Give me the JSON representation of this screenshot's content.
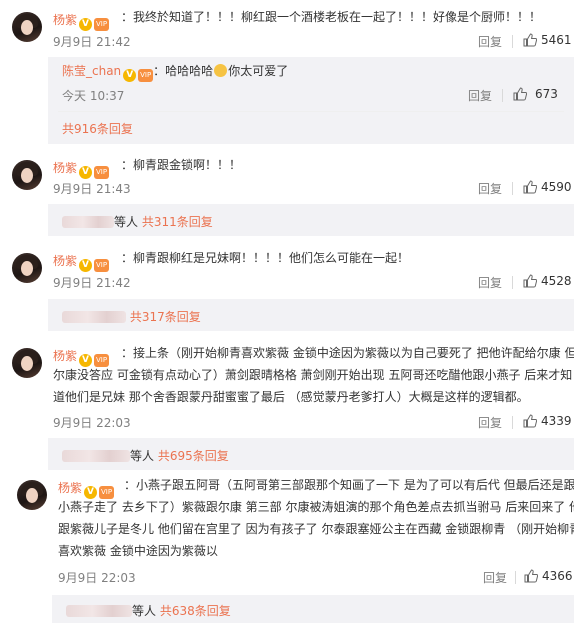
{
  "comments": [
    {
      "user": "杨紫",
      "text": "：我终於知道了！！！柳红跟一个酒楼老板在一起了！！！好像是个厨师！！！",
      "time": "9月9日 21:42",
      "reply_label": "回复",
      "likes": "5461",
      "sub": {
        "user": "陈莹_chan",
        "text": "：哈哈哈哈",
        "text2": "你太可爱了",
        "time": "今天 10:37",
        "reply_label": "回复",
        "likes": "673"
      },
      "more": "共916条回复"
    },
    {
      "user": "杨紫",
      "text": "：柳青跟金锁啊！！！",
      "time": "9月9日 21:43",
      "reply_label": "回复",
      "likes": "4590",
      "more_who": "等人",
      "more": "共311条回复"
    },
    {
      "user": "杨紫",
      "text": "：柳青跟柳红是兄妹啊！！！！他们怎么可能在一起！",
      "time": "9月9日 21:42",
      "reply_label": "回复",
      "likes": "4528",
      "more": "共317条回复"
    },
    {
      "user": "杨紫",
      "lines": [
        "：接上条（刚开始柳青喜欢紫薇 金锁中途因为紫薇以为自己要死了 把他许配给尔康 但",
        "尔康没答应 可金锁有点动心了）萧剑跟晴格格 萧剑刚开始出现 五阿哥还吃醋他跟小燕子 后来才知",
        "道他们是兄妹 那个舍香跟蒙丹甜蜜蜜了最后 （感觉蒙丹老爹打人）大概是这样的逻辑都。"
      ],
      "time": "9月9日 22:03",
      "reply_label": "回复",
      "likes": "4339",
      "more_who": "等人",
      "more": "共695条回复"
    },
    {
      "user": "杨紫",
      "lines": [
        "：小燕子跟五阿哥（五阿哥第三部跟那个知画了一下 是为了可以有后代 但最后还是跟",
        "小燕子走了 去乡下了）紫薇跟尔康 第三部 尔康被涛姐演的那个角色差点去抓当驸马 后来回来了 他",
        "跟紫薇儿子是冬儿 他们留在宫里了 因为有孩子了 尔泰跟塞娅公主在西藏 金锁跟柳青 （刚开始柳青",
        "喜欢紫薇 金锁中途因为紫薇以"
      ],
      "time": "9月9日 22:03",
      "reply_label": "回复",
      "likes": "4366",
      "more_who": "等人",
      "more": "共638条回复"
    }
  ],
  "colors": {
    "name": "#eb7350",
    "muted": "#808080",
    "panel": "#f2f2f5"
  },
  "icons": {
    "like": "thumbs-up-icon",
    "verified": "verified-v-icon",
    "vip": "vip-badge-icon",
    "emoji": "smiley-emoji-icon"
  }
}
